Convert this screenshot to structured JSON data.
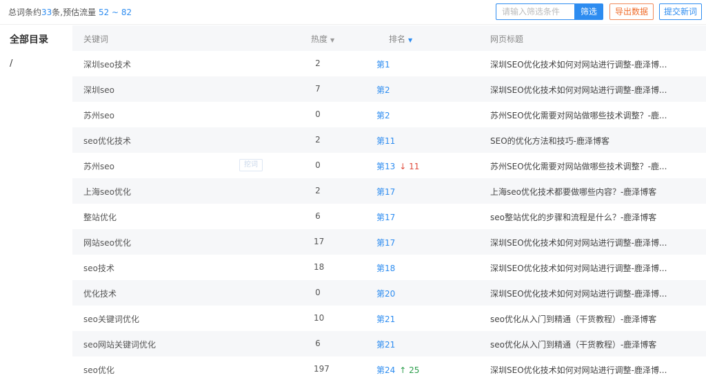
{
  "summary": {
    "prefix": "总词条约",
    "count": "33",
    "middle": "条,预估流量",
    "traffic": "52 ~ 82"
  },
  "toolbar": {
    "search_placeholder": "请输入筛选条件",
    "filter_label": "筛选",
    "export_label": "导出数据",
    "submit_label": "提交新词"
  },
  "sidebar": {
    "title": "全部目录",
    "root": "/"
  },
  "table": {
    "headers": {
      "keyword": "关键词",
      "heat": "热度",
      "rank": "排名",
      "title": "网页标题"
    },
    "ghost_label": "挖词",
    "rows": [
      {
        "keyword": "深圳seo技术",
        "heat": "2",
        "rank": "第1",
        "change": "",
        "title": "深圳SEO优化技术如何对网站进行调整-鹿泽博..."
      },
      {
        "keyword": "深圳seo",
        "heat": "7",
        "rank": "第2",
        "change": "",
        "title": "深圳SEO优化技术如何对网站进行调整-鹿泽博..."
      },
      {
        "keyword": "苏州seo",
        "heat": "0",
        "rank": "第2",
        "change": "",
        "title": "苏州SEO优化需要对网站做哪些技术调整？-鹿..."
      },
      {
        "keyword": "seo优化技术",
        "heat": "2",
        "rank": "第11",
        "change": "",
        "title": "SEO的优化方法和技巧-鹿泽博客"
      },
      {
        "keyword": "苏州seo",
        "heat": "0",
        "rank": "第13",
        "change": "↓ 11",
        "title": "苏州SEO优化需要对网站做哪些技术调整？-鹿..."
      },
      {
        "keyword": "上海seo优化",
        "heat": "2",
        "rank": "第17",
        "change": "",
        "title": "上海seo优化技术都要做哪些内容？-鹿泽博客"
      },
      {
        "keyword": "整站优化",
        "heat": "6",
        "rank": "第17",
        "change": "",
        "title": "seo整站优化的步骤和流程是什么？-鹿泽博客"
      },
      {
        "keyword": "网站seo优化",
        "heat": "17",
        "rank": "第17",
        "change": "",
        "title": "深圳SEO优化技术如何对网站进行调整-鹿泽博..."
      },
      {
        "keyword": "seo技术",
        "heat": "18",
        "rank": "第18",
        "change": "",
        "title": "深圳SEO优化技术如何对网站进行调整-鹿泽博..."
      },
      {
        "keyword": "优化技术",
        "heat": "0",
        "rank": "第20",
        "change": "",
        "title": "深圳SEO优化技术如何对网站进行调整-鹿泽博..."
      },
      {
        "keyword": "seo关键词优化",
        "heat": "10",
        "rank": "第21",
        "change": "",
        "title": "seo优化从入门到精通（干货教程）-鹿泽博客"
      },
      {
        "keyword": "seo网站关键词优化",
        "heat": "6",
        "rank": "第21",
        "change": "",
        "title": "seo优化从入门到精通（干货教程）-鹿泽博客"
      },
      {
        "keyword": "seo优化",
        "heat": "197",
        "rank": "第24",
        "change": "↑ 25",
        "title": "深圳SEO优化技术如何对网站进行调整-鹿泽博..."
      }
    ]
  },
  "colors": {
    "accent": "#2d8cf0",
    "export": "#ef6c2a",
    "down": "#e04b3c",
    "up": "#2a9d4a",
    "stripe": "#f6f7f9"
  }
}
